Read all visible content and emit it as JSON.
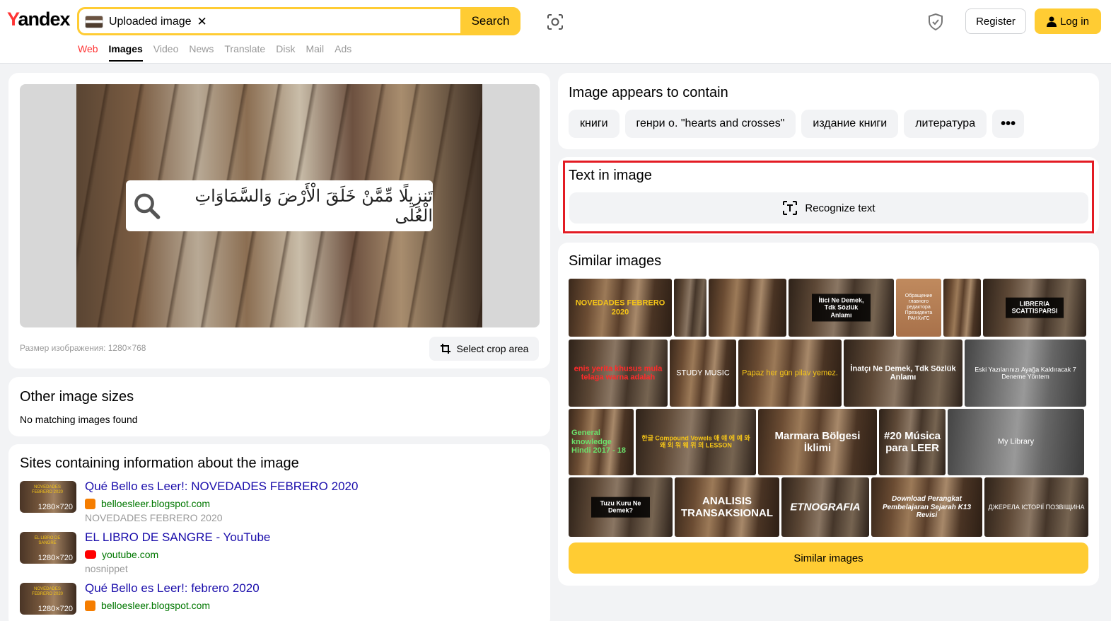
{
  "header": {
    "logo_y": "Y",
    "logo_rest": "andex",
    "search": {
      "chip_label": "Uploaded image",
      "chip_close": "✕",
      "button": "Search"
    },
    "register": "Register",
    "login": "Log in"
  },
  "nav": [
    {
      "label": "Web"
    },
    {
      "label": "Images",
      "active": true
    },
    {
      "label": "Video"
    },
    {
      "label": "News"
    },
    {
      "label": "Translate"
    },
    {
      "label": "Disk"
    },
    {
      "label": "Mail"
    },
    {
      "label": "Ads"
    }
  ],
  "main_image": {
    "overlay_text": "تَنزِيلًا مِّمَّنْ خَلَقَ الْأَرْضَ وَالسَّمَاوَاتِ الْعُلَى",
    "size_label": "Размер изображения: 1280×768",
    "crop_button": "Select crop area"
  },
  "other_sizes": {
    "title": "Other image sizes",
    "message": "No matching images found"
  },
  "sites": {
    "title": "Sites containing information about the image",
    "items": [
      {
        "title": "Qué Bello es Leer!: NOVEDADES FEBRERO 2020",
        "host": "belloesleer.blogspot.com",
        "snippet": "NOVEDADES FEBRERO 2020",
        "dims": "1280×720",
        "thumb_text": "NOVEDADES FEBRERO 2020",
        "favicon": "blogger"
      },
      {
        "title": "EL LIBRO DE SANGRE - YouTube",
        "host": "youtube.com",
        "snippet": "nosnippet",
        "dims": "1280×720",
        "thumb_text": "EL LIBRO DE SANGRE",
        "favicon": "youtube"
      },
      {
        "title": "Qué Bello es Leer!: febrero 2020",
        "host": "belloesleer.blogspot.com",
        "snippet": "",
        "dims": "1280×720",
        "thumb_text": "NOVEDADES FEBRERO 2020",
        "favicon": "blogger"
      }
    ]
  },
  "contains": {
    "title": "Image appears to contain",
    "tags": [
      "книги",
      "генри о. \"hearts and crosses\"",
      "издание книги",
      "литература"
    ],
    "more": "•••"
  },
  "text_in_image": {
    "title": "Text in image",
    "button": "Recognize text"
  },
  "similar": {
    "title": "Similar images",
    "button": "Similar images",
    "rows": [
      [
        {
          "text": "NOVEDADES FEBRERO 2020",
          "style": "yellow"
        },
        {
          "text": "",
          "style": ""
        },
        {
          "text": "",
          "style": ""
        },
        {
          "text": "İtici Ne Demek, Tdk Sözlük Anlamı",
          "style": "boxed"
        },
        {
          "text": "Обращение главного редактора Президента РАНХиГС",
          "style": "tan"
        },
        {
          "text": "",
          "style": ""
        },
        {
          "text": "LIBRERIA SCATTISPARSI",
          "style": "boxed"
        }
      ],
      [
        {
          "text": "enis yerita khusus mula telaga warna adalah",
          "style": "red"
        },
        {
          "text": "STUDY MUSIC",
          "style": "white"
        },
        {
          "text": "Papaz her gün pilav yemez.",
          "style": "yellow"
        },
        {
          "text": "İnatçı Ne Demek, Tdk Sözlük Anlamı",
          "style": "white"
        },
        {
          "text": "Eski Yazılarınızı Ayağa Kaldıracak 7 Deneme Yöntem",
          "style": "gray"
        }
      ],
      [
        {
          "text": "General knowledge Hindi 2017 - 18",
          "style": "green"
        },
        {
          "text": "한글 Compound Vowels 애 얘 에 예 와 왜 외 워 웨 위 의 LESSON",
          "style": "yellow"
        },
        {
          "text": "Marmara Bölgesi İklimi",
          "style": "white-big"
        },
        {
          "text": "#20 Música para LEER",
          "style": "white-big"
        },
        {
          "text": "My Library",
          "style": "gray"
        }
      ],
      [
        {
          "text": "Tuzu Kuru Ne Demek?",
          "style": "boxed"
        },
        {
          "text": "ANALISIS TRANSAKSIONAL",
          "style": "white-big"
        },
        {
          "text": "ETNOGRAFIA",
          "style": "white-big"
        },
        {
          "text": "Download Perangkat Pembelajaran Sejarah K13 Revisi",
          "style": "white"
        },
        {
          "text": "ДЖЕРЕЛА ІСТОРІЇ ПОЗВІЩИНА",
          "style": "white"
        }
      ]
    ]
  }
}
